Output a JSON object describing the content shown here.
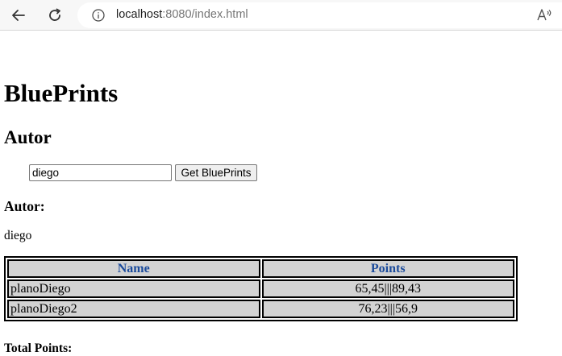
{
  "browser": {
    "url_host": "localhost",
    "url_rest": ":8080/index.html",
    "back_icon": "back-arrow-icon",
    "reload_icon": "reload-icon",
    "info_icon": "info-icon",
    "read_aloud_icon": "read-aloud-icon"
  },
  "page": {
    "title": "BluePrints",
    "subtitle": "Autor",
    "author_input_value": "diego",
    "get_button_label": "Get BluePrints",
    "autor_heading": "Autor:",
    "autor_value": "diego",
    "total_points_label": "Total Points:",
    "total_points_value": ""
  },
  "table": {
    "headers": [
      "Name",
      "Points"
    ],
    "rows": [
      {
        "name": "planoDiego",
        "points": "65,45|||89,43"
      },
      {
        "name": "planoDiego2",
        "points": "76,23|||56,9"
      }
    ]
  },
  "colors": {
    "header_text": "#1a4a9b",
    "cell_background": "#d3d3d3"
  }
}
